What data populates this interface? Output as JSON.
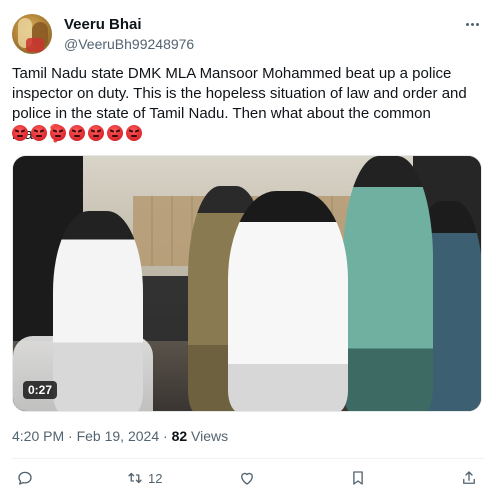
{
  "author": {
    "display_name": "Veeru Bhai",
    "handle": "@VeeruBh99248976",
    "avatar_icon": "avatar-image"
  },
  "tweet": {
    "text": "Tamil Nadu state DMK MLA Mansoor Mohammed beat up a police inspector on duty. This is the hopeless situation of law and order and police in the state of Tamil Nadu. Then what about the common man",
    "trailing_symbol": "❓",
    "emoji_count": 7,
    "emoji_icon": "angry-face-emoji"
  },
  "media": {
    "type": "video",
    "duration": "0:27"
  },
  "meta": {
    "time": "4:20 PM",
    "separator": "·",
    "date": "Feb 19, 2024",
    "views_count": "82",
    "views_label": "Views"
  },
  "actions": {
    "reply_icon": "reply-icon",
    "repost_icon": "repost-icon",
    "repost_count": "12",
    "like_icon": "heart-icon",
    "bookmark_icon": "bookmark-icon",
    "share_icon": "share-icon"
  },
  "colors": {
    "text": "#0f1419",
    "secondary": "#536471",
    "emoji_red": "#d9262c",
    "divider": "#eff3f4"
  }
}
